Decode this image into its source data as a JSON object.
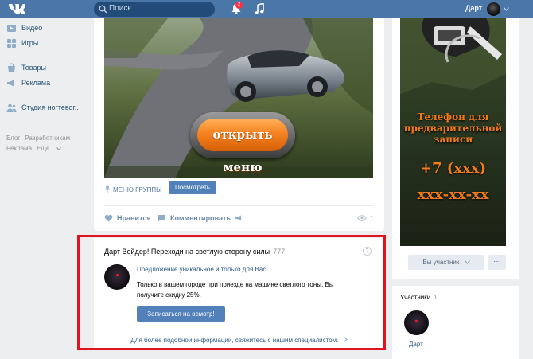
{
  "topbar": {
    "search_placeholder": "Поиск",
    "notification_count": "2",
    "username": "Дарт"
  },
  "sidebar": {
    "items": [
      {
        "label": "Видео",
        "icon": "video-icon"
      },
      {
        "label": "Игры",
        "icon": "games-icon"
      },
      {
        "label": "Товары",
        "icon": "market-icon"
      },
      {
        "label": "Реклама",
        "icon": "ads-icon"
      },
      {
        "label": "Студия ногтевог..",
        "icon": "community-icon"
      }
    ],
    "footer_links": [
      "Блог",
      "Разработчикам",
      "Реклама",
      "Ещё"
    ]
  },
  "post": {
    "image_button": "открыть меню",
    "group_menu_label": "МЕНЮ ГРУППЫ",
    "view_button": "Посмотреть",
    "like_label": "Нравится",
    "comment_label": "Комментировать",
    "views_count": "1"
  },
  "ad": {
    "title": "Дарт Вейдер! Переходи на светлую сторону силы",
    "title_count": "777",
    "help": "?",
    "link": "Предложение уникальное и только для Вас!",
    "text": "Только в вашем городе при приезде на машине светлого тоны, Вы получите скидку 25%.",
    "button": "Записаться на осмотр!",
    "footer": "Для более подобной информации, свяжитесь с нашим специалистом."
  },
  "cover": {
    "line1": "Телефон для",
    "line2": "предварительной",
    "line3": "записи",
    "phone1": "+7 (ххх)",
    "phone2": "ххх-хх-хх"
  },
  "group_actions": {
    "member_button": "Вы участник",
    "more_button": "···"
  },
  "members": {
    "title": "Участники",
    "count": "1",
    "name": "Дарт"
  },
  "colors": {
    "topbar": "#4a76a8",
    "button": "#5181b8",
    "highlight_frame": "#e0141e",
    "cta_orange": "#f58220",
    "background": "#edeef0"
  }
}
